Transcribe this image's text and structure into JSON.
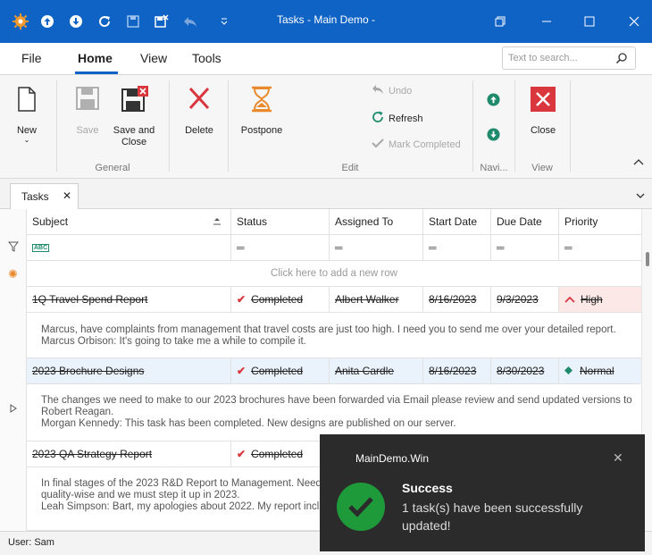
{
  "window": {
    "title": "Tasks - Main Demo -"
  },
  "menu": {
    "tabs": [
      "File",
      "Home",
      "View",
      "Tools"
    ],
    "active": "Home"
  },
  "search": {
    "placeholder": "Text to search..."
  },
  "ribbon": {
    "new_label": "New",
    "save_label": "Save",
    "save_close_label": "Save and Close",
    "delete_label": "Delete",
    "postpone_label": "Postpone",
    "undo_label": "Undo",
    "refresh_label": "Refresh",
    "mark_completed_label": "Mark Completed",
    "close_label": "Close",
    "groups": {
      "general": "General",
      "edit": "Edit",
      "navigation": "Navi...",
      "view": "View"
    }
  },
  "doc_tab": {
    "label": "Tasks"
  },
  "grid": {
    "columns": [
      "Subject",
      "Status",
      "Assigned To",
      "Start Date",
      "Due Date",
      "Priority"
    ],
    "new_row_text": "Click here to add a new row",
    "rows": [
      {
        "subject": "1Q Travel Spend Report",
        "status": "Completed",
        "assigned": "Albert Walker",
        "start": "8/16/2023",
        "due": "9/3/2023",
        "priority": "High",
        "preview": [
          "Marcus, have complaints from management that travel costs are just too high. I need you to send me over your detailed report.",
          "Marcus Orbison: It's going to take me a while to compile it."
        ]
      },
      {
        "subject": "2023 Brochure Designs",
        "status": "Completed",
        "assigned": "Anita Cardle",
        "start": "8/16/2023",
        "due": "8/30/2023",
        "priority": "Normal",
        "preview": [
          "The changes we need to make to our 2023 brochures have been forwarded via Email please review and send updated versions to",
          "Robert Reagan.",
          "Morgan Kennedy: This task has been completed. New designs are published on our server."
        ]
      },
      {
        "subject": "2023 QA Strategy Report",
        "status": "Completed",
        "preview": [
          "In final stages of the 2023 R&D Report to Management. Need QA",
          "quality-wise and we must step it up in 2023.",
          "Leah Simpson: Bart, my apologies about 2022. My report includes"
        ]
      }
    ]
  },
  "status_bar": {
    "user": "User: Sam"
  },
  "toast": {
    "app": "MainDemo.Win",
    "title": "Success",
    "message": "1 task(s) have been successfully updated!"
  },
  "colors": {
    "accent": "#0f63c4",
    "delete_red": "#d9363e",
    "postpone_orange": "#e8892b",
    "nav_green": "#1f8a6c",
    "success_green": "#1f9a3a",
    "high_bg": "#fde8e8"
  }
}
